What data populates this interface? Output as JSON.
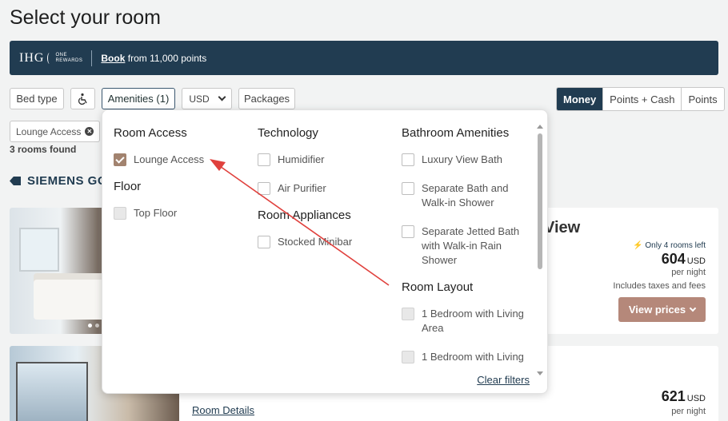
{
  "page": {
    "title": "Select your room"
  },
  "banner": {
    "brand": "IHG",
    "brand_sub_1": "ONE",
    "brand_sub_2": "REWARDS",
    "book_link": "Book",
    "book_text": "from 11,000 points"
  },
  "filters": {
    "bed_type": "Bed type",
    "accessible_icon": "wheelchair-icon",
    "amenities": "Amenities (1)",
    "currency": "USD",
    "packages": "Packages"
  },
  "payment": {
    "options": [
      "Money",
      "Points + Cash",
      "Points"
    ],
    "selected": "Money"
  },
  "active_filter_chip": "Lounge Access",
  "rooms_found": "3 rooms found",
  "hotel_name": "SIEMENS GO",
  "dropdown": {
    "room_access": {
      "heading": "Room Access",
      "options": [
        {
          "label": "Lounge Access",
          "checked": true
        }
      ]
    },
    "floor": {
      "heading": "Floor",
      "options": [
        {
          "label": "Top Floor",
          "disabled": true
        }
      ]
    },
    "technology": {
      "heading": "Technology",
      "options": [
        {
          "label": "Humidifier"
        },
        {
          "label": "Air Purifier"
        }
      ]
    },
    "room_appliances": {
      "heading": "Room Appliances",
      "options": [
        {
          "label": "Stocked Minibar"
        }
      ]
    },
    "bathroom": {
      "heading": "Bathroom Amenities",
      "options": [
        {
          "label": "Luxury View Bath"
        },
        {
          "label": "Separate Bath and Walk-in Shower"
        },
        {
          "label": "Separate Jetted Bath with Walk-in Rain Shower"
        }
      ]
    },
    "room_layout": {
      "heading": "Room Layout",
      "options": [
        {
          "label": "1 Bedroom with Living Area",
          "disabled": true
        },
        {
          "label": "1 Bedroom with Living",
          "disabled": true
        }
      ]
    },
    "clear_filters": "Clear filters"
  },
  "rooms": [
    {
      "name_fragment": "View",
      "availability": "Only 4 rooms left",
      "price": "604",
      "currency": "USD",
      "per_night": "per night",
      "taxes": "Includes taxes and fees",
      "cta": "View prices"
    },
    {
      "price": "621",
      "currency": "USD",
      "per_night": "per night",
      "details_link": "Room Details"
    }
  ],
  "colors": {
    "brand_navy": "#213c51",
    "accent_tan": "#b5887a",
    "annotation_arrow": "#e0413d"
  }
}
